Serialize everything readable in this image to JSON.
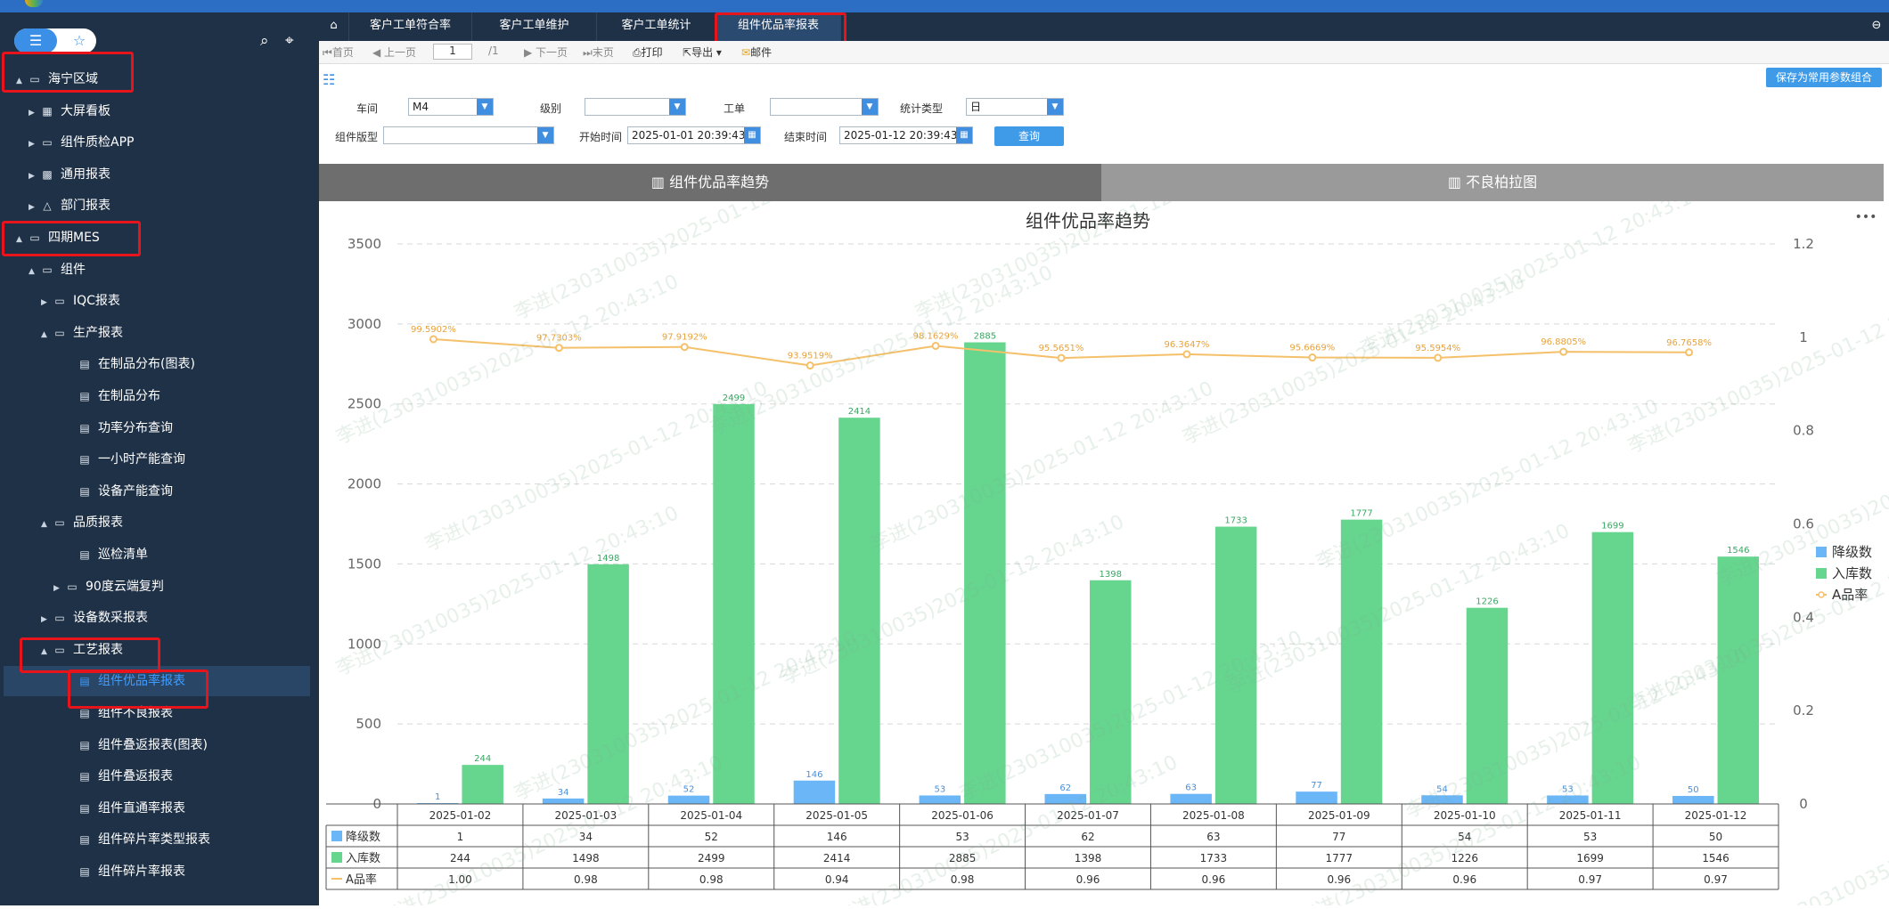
{
  "sidebar": {
    "items": [
      {
        "label": "海宁区域",
        "arrow": "▲",
        "icon": "▭"
      },
      {
        "label": "大屏看板",
        "arrow": "▶",
        "icon": "▦"
      },
      {
        "label": "组件质检APP",
        "arrow": "▶",
        "icon": "▭"
      },
      {
        "label": "通用报表",
        "arrow": "▶",
        "icon": "▩"
      },
      {
        "label": "部门报表",
        "arrow": "▶",
        "icon": "△"
      },
      {
        "label": "四期MES",
        "arrow": "▲",
        "icon": "▭"
      },
      {
        "label": "组件",
        "arrow": "▲",
        "icon": "▭"
      },
      {
        "label": "IQC报表",
        "arrow": "▶",
        "icon": "▭"
      },
      {
        "label": "生产报表",
        "arrow": "▲",
        "icon": "▭"
      },
      {
        "label": "在制品分布(图表)",
        "arrow": "",
        "icon": "▤"
      },
      {
        "label": "在制品分布",
        "arrow": "",
        "icon": "▤"
      },
      {
        "label": "功率分布查询",
        "arrow": "",
        "icon": "▤"
      },
      {
        "label": "一小时产能查询",
        "arrow": "",
        "icon": "▤"
      },
      {
        "label": "设备产能查询",
        "arrow": "",
        "icon": "▤"
      },
      {
        "label": "品质报表",
        "arrow": "▲",
        "icon": "▭"
      },
      {
        "label": "巡检清单",
        "arrow": "",
        "icon": "▤"
      },
      {
        "label": "90度云端复判",
        "arrow": "▶",
        "icon": "▭"
      },
      {
        "label": "设备数采报表",
        "arrow": "▶",
        "icon": "▭"
      },
      {
        "label": "工艺报表",
        "arrow": "▲",
        "icon": "▭"
      },
      {
        "label": "组件优品率报表",
        "arrow": "",
        "icon": "▤"
      },
      {
        "label": "组件不良报表",
        "arrow": "",
        "icon": "▤"
      },
      {
        "label": "组件叠返报表(图表)",
        "arrow": "",
        "icon": "▤"
      },
      {
        "label": "组件叠返报表",
        "arrow": "",
        "icon": "▤"
      },
      {
        "label": "组件直通率报表",
        "arrow": "",
        "icon": "▤"
      },
      {
        "label": "组件碎片率类型报表",
        "arrow": "",
        "icon": "▤"
      },
      {
        "label": "组件碎片率报表",
        "arrow": "",
        "icon": "▤"
      }
    ]
  },
  "tabs": [
    "客户工单符合率",
    "客户工单维护",
    "客户工单统计",
    "组件优品率报表"
  ],
  "toolbar": {
    "first": "首页",
    "prev": "上一页",
    "page": "1",
    "total": "/1",
    "next": "下一页",
    "last": "末页",
    "print": "打印",
    "export": "导出",
    "email": "邮件"
  },
  "params": {
    "workshop_label": "车间",
    "workshop_value": "M4",
    "grade_label": "级别",
    "grade_value": "",
    "order_label": "工单",
    "order_value": "",
    "stat_type_label": "统计类型",
    "stat_type_value": "日",
    "comp_type_label": "组件版型",
    "comp_type_value": "",
    "start_label": "开始时间",
    "start_value": "2025-01-01 20:39:43",
    "end_label": "结束时间",
    "end_value": "2025-01-12 20:39:43",
    "query_label": "查询",
    "save_label": "保存为常用参数组合"
  },
  "subtabs": [
    "组件优品率趋势",
    "不良柏拉图"
  ],
  "watermark": "李进(230310035)2025-01-12 20:43:10",
  "colors": {
    "downgrade": "#6bb6f7",
    "stock": "#66d68f",
    "rate": "#f5c06a",
    "tab_active": "#6e6e6e",
    "tab_inactive": "#9a9a9a"
  },
  "chart_data": {
    "type": "bar",
    "title": "组件优品率趋势",
    "categories": [
      "2025-01-02",
      "2025-01-03",
      "2025-01-04",
      "2025-01-05",
      "2025-01-06",
      "2025-01-07",
      "2025-01-08",
      "2025-01-09",
      "2025-01-10",
      "2025-01-11",
      "2025-01-12"
    ],
    "series": [
      {
        "name": "降级数",
        "type": "bar",
        "values": [
          1,
          34,
          52,
          146,
          53,
          62,
          63,
          77,
          54,
          53,
          50
        ]
      },
      {
        "name": "入库数",
        "type": "bar",
        "values": [
          244,
          1498,
          2499,
          2414,
          2885,
          1398,
          1733,
          1777,
          1226,
          1699,
          1546
        ]
      },
      {
        "name": "A品率",
        "type": "line",
        "axis": "right",
        "values": [
          0.995902,
          0.977303,
          0.979192,
          0.939519,
          0.981629,
          0.955651,
          0.963647,
          0.956669,
          0.955954,
          0.968805,
          0.967658
        ],
        "labels": [
          "99.5902%",
          "97.7303%",
          "97.9192%",
          "93.9519%",
          "98.1629%",
          "95.5651%",
          "96.3647%",
          "95.6669%",
          "95.5954%",
          "96.8805%",
          "96.7658%"
        ],
        "table_values": [
          "1.00",
          "0.98",
          "0.98",
          "0.94",
          "0.98",
          "0.96",
          "0.96",
          "0.96",
          "0.96",
          "0.97",
          "0.97"
        ]
      }
    ],
    "ylim": [
      0,
      3500
    ],
    "y_ticks": [
      0,
      500,
      1000,
      1500,
      2000,
      2500,
      3000,
      3500
    ],
    "y2lim": [
      0,
      1.2
    ],
    "y2_ticks": [
      0,
      0.2,
      0.4,
      0.6,
      0.8,
      1,
      1.2
    ],
    "grid": true,
    "legend": "right",
    "menu_icon": "•••"
  }
}
